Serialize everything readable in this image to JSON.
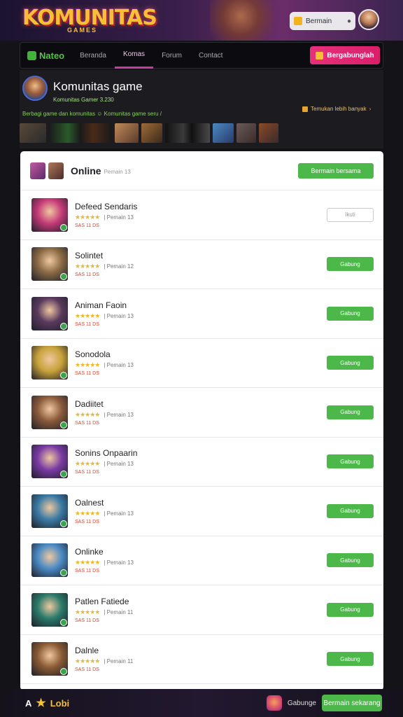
{
  "header": {
    "logo": "KOMUNITAS",
    "logo_sub": "GAMES",
    "user_chip_label": "Bermain",
    "user_chip_dot": "●"
  },
  "nav": {
    "brand": "Nateo",
    "tabs": [
      {
        "label": "Beranda",
        "active": false
      },
      {
        "label": "Komas",
        "active": true
      },
      {
        "label": "Forum",
        "active": false
      },
      {
        "label": "Contact",
        "active": false
      }
    ],
    "cta_label": "Bergabunglah"
  },
  "community": {
    "title": "Komunitas game",
    "subtitle": "Komunitas Gamer 3.230",
    "link_label": "Temukan lebih banyak",
    "link_chevron": "›",
    "tags": "Berbagi game dan komunitas ☺ Komunitas game seru /"
  },
  "panel": {
    "title": "Online",
    "count": "Pemain 13",
    "head_button": "Bermain bersama"
  },
  "rows": [
    {
      "name": "Defeed Sendaris",
      "stars": "★★★★★",
      "meta": "| Pemain 13",
      "tag": "SAS 11 DS",
      "button": "Ikuti",
      "ghost": true,
      "color": "#c43a78"
    },
    {
      "name": "Solintet",
      "stars": "★★★★★",
      "meta": "| Pemain 12",
      "tag": "SAS 11 DS",
      "button": "Gabung",
      "ghost": false,
      "color": "#8a6a44"
    },
    {
      "name": "Animan Faoin",
      "stars": "★★★★★",
      "meta": "| Pemain 13",
      "tag": "SAS 11 DS",
      "button": "Gabung",
      "ghost": false,
      "color": "#5a3a5e"
    },
    {
      "name": "Sonodola",
      "stars": "★★★★★",
      "meta": "| Pemain 13",
      "tag": "SAS 11 DS",
      "button": "Gabung",
      "ghost": false,
      "color": "#c8a23a"
    },
    {
      "name": "Dadiitet",
      "stars": "★★★★★",
      "meta": "| Pemain 13",
      "tag": "SAS 11 DS",
      "button": "Gabung",
      "ghost": false,
      "color": "#8a5a3a"
    },
    {
      "name": "Sonins Onpaarin",
      "stars": "★★★★★",
      "meta": "| Pemain 13",
      "tag": "SAS 11 DS",
      "button": "Gabung",
      "ghost": false,
      "color": "#7a3aa4"
    },
    {
      "name": "Oalnest",
      "stars": "★★★★★",
      "meta": "| Pemain 13",
      "tag": "SAS 11 DS",
      "button": "Gabung",
      "ghost": false,
      "color": "#3a7aa4"
    },
    {
      "name": "Onlinke",
      "stars": "★★★★★",
      "meta": "| Pemain 13",
      "tag": "SAS 11 DS",
      "button": "Gabung",
      "ghost": false,
      "color": "#4a8ac4"
    },
    {
      "name": "Patlen Fatiede",
      "stars": "★★★★★",
      "meta": "| Pemain 11",
      "tag": "SAS 11 DS",
      "button": "Gabung",
      "ghost": false,
      "color": "#2a7a6a"
    },
    {
      "name": "Dalnle",
      "stars": "★★★★★",
      "meta": "| Pemain 11",
      "tag": "SAS 11 DS",
      "button": "Gabung",
      "ghost": false,
      "color": "#8a5a34"
    }
  ],
  "bottombar": {
    "left_icon": "A",
    "left_label": "Lobi",
    "right_label": "Gabunge",
    "button": "Bermain sekarang"
  },
  "colors": {
    "accent_green": "#4cb84a",
    "accent_pink": "#e8307a",
    "gold": "#f6c034"
  }
}
